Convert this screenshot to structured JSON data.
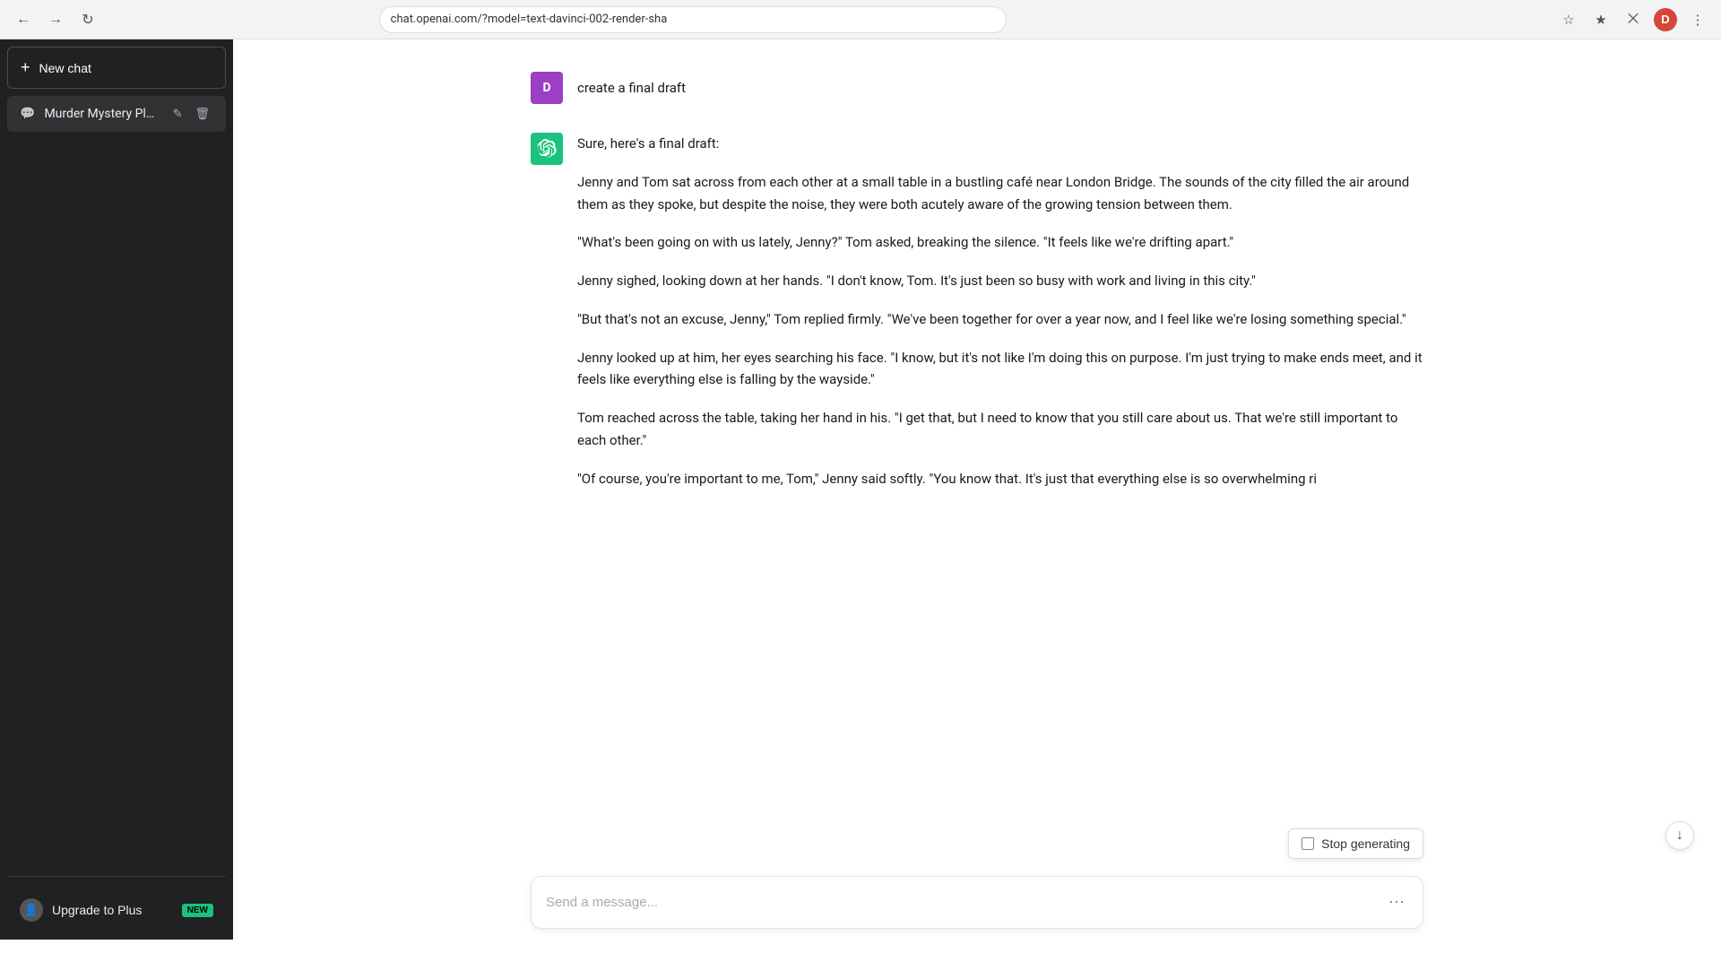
{
  "browser": {
    "url": "chat.openai.com/?model=text-davinci-002-render-sha",
    "back_title": "Back",
    "forward_title": "Forward",
    "reload_title": "Reload",
    "profile_initial": "D"
  },
  "sidebar": {
    "new_chat_label": "New chat",
    "new_chat_plus": "+",
    "chat_item": {
      "title": "Murder Mystery Plot.",
      "icon": "💬"
    },
    "upgrade": {
      "label": "Upgrade to Plus",
      "badge": "NEW",
      "icon": "👤"
    }
  },
  "chat": {
    "user_message": "create a final draft",
    "user_initial": "D",
    "assistant_intro": "Sure, here's a final draft:",
    "paragraphs": [
      "Jenny and Tom sat across from each other at a small table in a bustling café near London Bridge. The sounds of the city filled the air around them as they spoke, but despite the noise, they were both acutely aware of the growing tension between them.",
      "\"What's been going on with us lately, Jenny?\" Tom asked, breaking the silence. \"It feels like we're drifting apart.\"",
      "Jenny sighed, looking down at her hands. \"I don't know, Tom. It's just been so busy with work and living in this city.\"",
      "\"But that's not an excuse, Jenny,\" Tom replied firmly. \"We've been together for over a year now, and I feel like we're losing something special.\"",
      "Jenny looked up at him, her eyes searching his face. \"I know, but it's not like I'm doing this on purpose. I'm just trying to make ends meet, and it feels like everything else is falling by the wayside.\"",
      "Tom reached across the table, taking her hand in his. \"I get that, but I need to know that you still care about us. That we're still important to each other.\"",
      "\"Of course, you're important to me, Tom,\" Jenny said softly. \"You know that. It's just that everything else is so overwhelming ri"
    ]
  },
  "input": {
    "placeholder": "Send a message...",
    "more_options_label": "More options"
  },
  "stop_generating": {
    "label": "Stop generating"
  },
  "icons": {
    "plus": "+",
    "chat": "💬",
    "edit": "✏",
    "trash": "🗑",
    "dots": "⋯",
    "chevron_down": "↓",
    "user": "👤",
    "bookmark": "☆",
    "star": "★",
    "extension": "⊞",
    "menu": "≡"
  }
}
